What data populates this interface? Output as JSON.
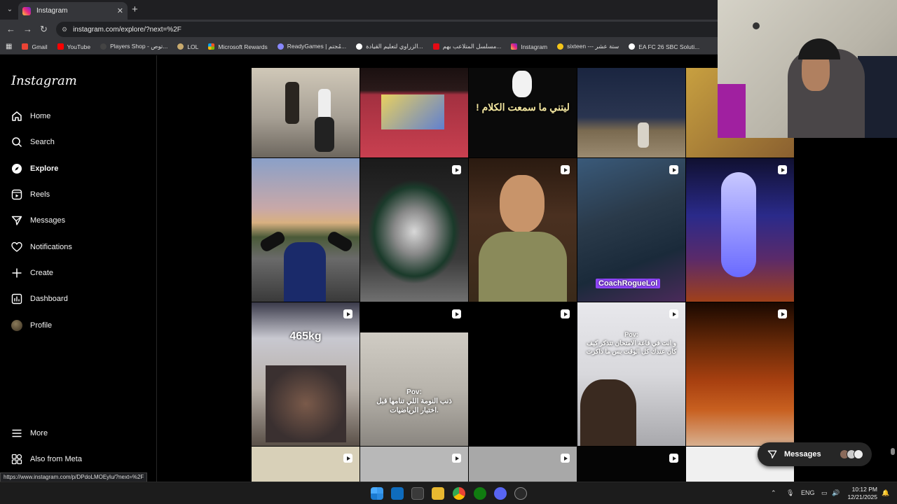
{
  "browser": {
    "tab_title": "Instagram",
    "url": "instagram.com/explore/?next=%2F",
    "status_url": "https://www.instagram.com/p/DPdoLMOEylu/?next=%2F",
    "bookmarks": [
      {
        "label": "Gmail",
        "color": "#ea4335"
      },
      {
        "label": "YouTube",
        "color": "#ff0000"
      },
      {
        "label": "Players Shop - توص...",
        "color": "#444444"
      },
      {
        "label": "LOL",
        "color": "#c8aa6e"
      },
      {
        "label": "Microsoft Rewards",
        "color": "#f25022"
      },
      {
        "label": "ReadyGames | مُجتم...",
        "color": "#8888ff"
      },
      {
        "label": "الزراوي لتعليم القيادة...",
        "color": "#ffffff"
      },
      {
        "label": "مسلسل المتلاعب بهم...",
        "color": "#e50914"
      },
      {
        "label": "Instagram",
        "color": "#e1306c"
      },
      {
        "label": "sixteen --- ستة عشر",
        "color": "#f5c518"
      },
      {
        "label": "EA FC 26 SBC Soluti...",
        "color": "#ffffff"
      }
    ]
  },
  "sidebar": {
    "logo": "Instagram",
    "items": [
      {
        "label": "Home",
        "icon": "home-icon"
      },
      {
        "label": "Search",
        "icon": "search-icon"
      },
      {
        "label": "Explore",
        "icon": "compass-icon",
        "active": true
      },
      {
        "label": "Reels",
        "icon": "reels-icon"
      },
      {
        "label": "Messages",
        "icon": "messenger-icon"
      },
      {
        "label": "Notifications",
        "icon": "heart-icon"
      },
      {
        "label": "Create",
        "icon": "plus-icon"
      },
      {
        "label": "Dashboard",
        "icon": "chart-icon"
      },
      {
        "label": "Profile",
        "icon": "avatar"
      }
    ],
    "bottom_items": [
      {
        "label": "More",
        "icon": "menu-icon"
      },
      {
        "label": "Also from Meta",
        "icon": "meta-icon"
      }
    ]
  },
  "grid": {
    "tiles": [
      {
        "text": "",
        "reel": false
      },
      {
        "text": "",
        "reel": false
      },
      {
        "text": "! ليتني ما سمعت الكلام",
        "reel": false
      },
      {
        "text": "",
        "reel": false
      },
      {
        "text": "",
        "reel": false
      },
      {
        "text": "",
        "reel": true
      },
      {
        "text": "",
        "reel": false
      },
      {
        "text": "",
        "reel": true
      },
      {
        "text": "CoachRogueLol",
        "reel": true
      },
      {
        "text": "",
        "reel": true
      },
      {
        "text": "465kg",
        "reel": true
      },
      {
        "text": "Pov:\nذنب النومة اللي تنامها قبل\nاختبار الرياضيات.",
        "reel": true
      },
      {
        "text": "",
        "reel": true
      },
      {
        "text": "Pov:\nو انت في قاعة الامتحان تتذكر كيف\nكان عندك كل الوقت بس ما ذاكرت",
        "reel": true
      },
      {
        "text": "",
        "reel": true
      }
    ]
  },
  "messages_pill": {
    "label": "Messages"
  },
  "taskbar": {
    "lang": "ENG",
    "time": "10:12 PM",
    "date": "12/21/2025"
  }
}
